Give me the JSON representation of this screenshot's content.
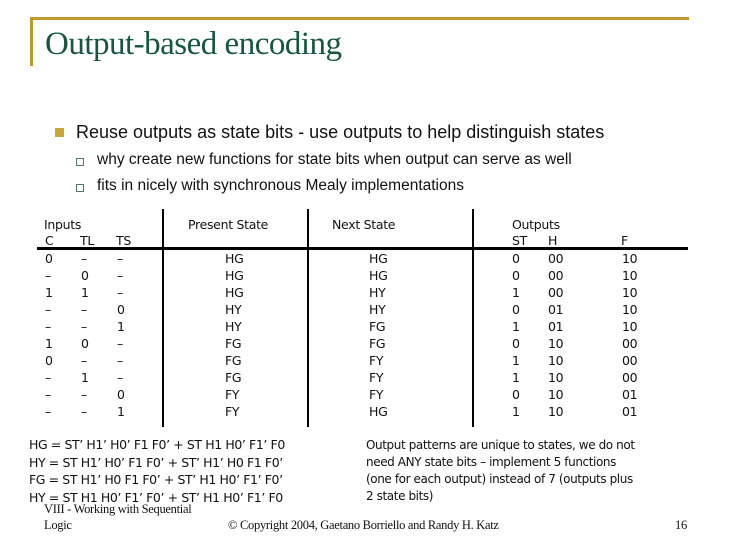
{
  "title": "Output-based encoding",
  "bullets": [
    {
      "text": "Reuse outputs as state bits - use outputs to help distinguish states",
      "sub": [
        "why create new functions for state bits when output can serve as well",
        "fits in nicely with synchronous Mealy implementations"
      ]
    }
  ],
  "table": {
    "group_headers": {
      "inputs": "Inputs",
      "present_state": "Present State",
      "next_state": "Next State",
      "outputs": "Outputs"
    },
    "columns": [
      "C",
      "TL",
      "TS",
      "ST",
      "H",
      "F"
    ],
    "rows": [
      {
        "C": "0",
        "TL": "–",
        "TS": "–",
        "present": "HG",
        "next": "HG",
        "ST": "0",
        "H": "00",
        "F": "10"
      },
      {
        "C": "–",
        "TL": "0",
        "TS": "–",
        "present": "HG",
        "next": "HG",
        "ST": "0",
        "H": "00",
        "F": "10"
      },
      {
        "C": "1",
        "TL": "1",
        "TS": "–",
        "present": "HG",
        "next": "HY",
        "ST": "1",
        "H": "00",
        "F": "10"
      },
      {
        "C": "–",
        "TL": "–",
        "TS": "0",
        "present": "HY",
        "next": "HY",
        "ST": "0",
        "H": "01",
        "F": "10"
      },
      {
        "C": "–",
        "TL": "–",
        "TS": "1",
        "present": "HY",
        "next": "FG",
        "ST": "1",
        "H": "01",
        "F": "10"
      },
      {
        "C": "1",
        "TL": "0",
        "TS": "–",
        "present": "FG",
        "next": "FG",
        "ST": "0",
        "H": "10",
        "F": "00"
      },
      {
        "C": "0",
        "TL": "–",
        "TS": "–",
        "present": "FG",
        "next": "FY",
        "ST": "1",
        "H": "10",
        "F": "00"
      },
      {
        "C": "–",
        "TL": "1",
        "TS": "–",
        "present": "FG",
        "next": "FY",
        "ST": "1",
        "H": "10",
        "F": "00"
      },
      {
        "C": "–",
        "TL": "–",
        "TS": "0",
        "present": "FY",
        "next": "FY",
        "ST": "0",
        "H": "10",
        "F": "01"
      },
      {
        "C": "–",
        "TL": "–",
        "TS": "1",
        "present": "FY",
        "next": "HG",
        "ST": "1",
        "H": "10",
        "F": "01"
      }
    ]
  },
  "equations": [
    "HG = ST’ H1’ H0’ F1 F0’ + ST H1 H0’ F1’ F0",
    "HY = ST H1’ H0’ F1 F0’ + ST’ H1’ H0 F1 F0’",
    "FG = ST H1’ H0 F1 F0’ + ST’ H1 H0’ F1’ F0’",
    "HY = ST H1 H0’ F1’ F0’ + ST’ H1 H0’ F1’ F0"
  ],
  "note": [
    "Output patterns are unique to states, we do not",
    "need ANY state bits – implement 5 functions",
    "(one for each output) instead of 7 (outputs plus",
    "2 state bits)"
  ],
  "footer": {
    "course_line1": "VIII - Working with Sequential",
    "course_line2": "Logic",
    "copyright": "© Copyright 2004, Gaetano Borriello and Randy H. Katz",
    "page_number": "16"
  },
  "colors": {
    "title": "#17573F",
    "accent_rule": "#C29A2C",
    "bullet": "#C9A53A",
    "sub_bullet": "#4E7A66"
  }
}
